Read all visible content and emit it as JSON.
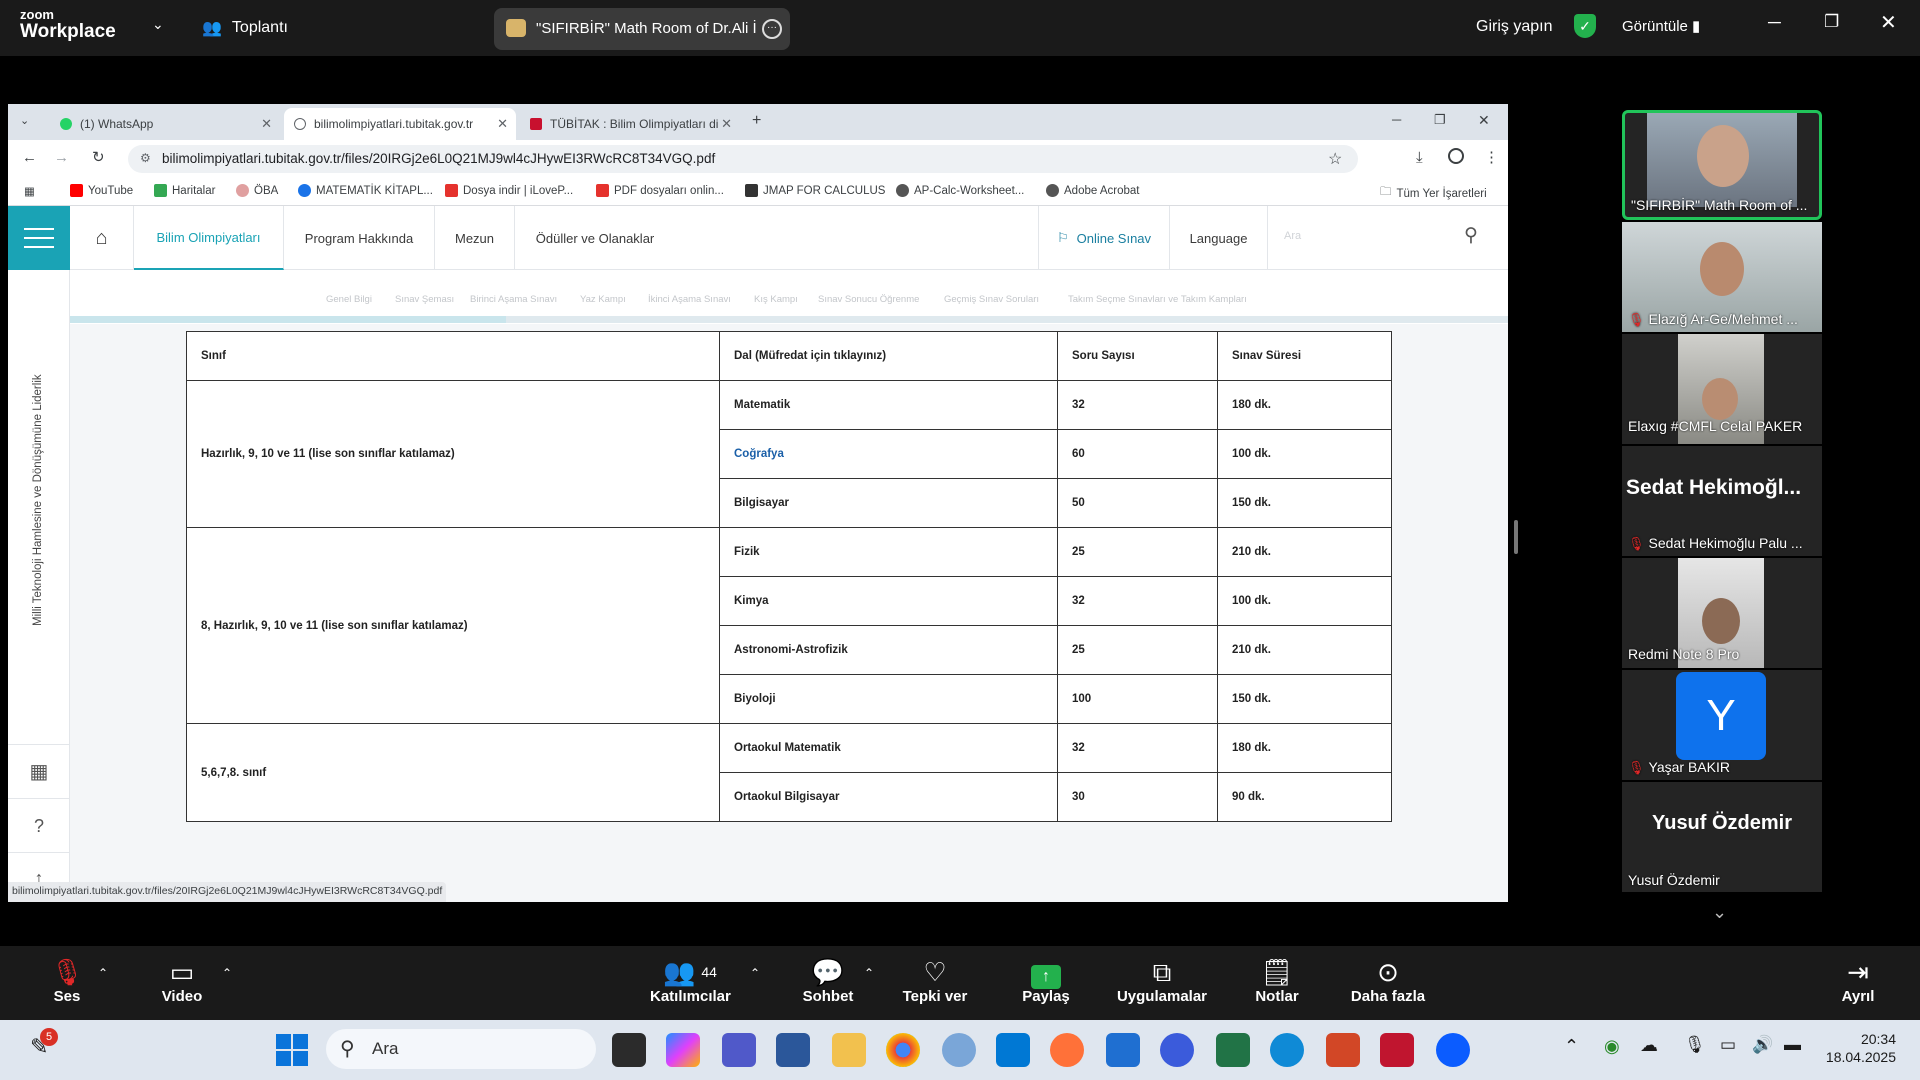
{
  "zoom": {
    "brand_top": "zoom",
    "brand_bottom": "Workplace",
    "meeting_menu": "Toplantı",
    "room_title": "\"SIFIRBİR\" Math Room of Dr.Ali İ",
    "signin": "Giriş yapın",
    "view": "Görüntüle"
  },
  "browser": {
    "tabs": [
      {
        "label": "(1) WhatsApp",
        "active": false
      },
      {
        "label": "bilimolimpiyatlari.tubitak.gov.tr",
        "active": true
      },
      {
        "label": "TÜBİTAK : Bilim Olimpiyatları di",
        "active": false
      }
    ],
    "url": "bilimolimpiyatlari.tubitak.gov.tr/files/20IRGj2e6L0Q21MJ9wl4cJHywEI3RWcRC8T34VGQ.pdf",
    "bookmarks": [
      "YouTube",
      "Haritalar",
      "ÖBA",
      "MATEMATİK KİTAPL...",
      "Dosya indir | iLoveP...",
      "PDF dosyaları onlin...",
      "JMAP FOR CALCULUS",
      "AP-Calc-Worksheet...",
      "Adobe Acrobat"
    ],
    "all_bookmarks": "Tüm Yer İşaretleri",
    "status_url": "bilimolimpiyatlari.tubitak.gov.tr/files/20IRGj2e6L0Q21MJ9wl4cJHywEI3RWcRC8T34VGQ.pdf"
  },
  "site": {
    "nav": [
      "Bilim Olimpiyatları",
      "Program Hakkında",
      "Mezun",
      "Ödüller ve Olanaklar"
    ],
    "online": "Online Sınav",
    "language": "Language",
    "search_placeholder": "Ara",
    "subnav": [
      "Genel Bilgi",
      "Sınav Şeması",
      "Birinci Aşama Sınavı",
      "Yaz Kampı",
      "İkinci Aşama Sınavı",
      "Kış Kampı",
      "Sınav Sonucu Öğrenme",
      "Geçmiş Sınav Soruları",
      "Takım Seçme Sınavları ve Takım Kampları"
    ],
    "sidebar_text": "Milli Teknoloji Hamlesine ve Dönüşümüne Liderlik"
  },
  "table": {
    "headers": [
      "Sınıf",
      "Dal (Müfredat için tıklayınız)",
      "Soru Sayısı",
      "Sınav Süresi"
    ],
    "groups": [
      {
        "class": "Hazırlık, 9, 10 ve 11 (lise son sınıflar katılamaz)",
        "rows": [
          [
            "Matematik",
            "32",
            "180 dk."
          ],
          [
            "Coğrafya",
            "60",
            "100 dk."
          ],
          [
            "Bilgisayar",
            "50",
            "150 dk."
          ]
        ]
      },
      {
        "class": "8, Hazırlık, 9, 10 ve 11 (lise son sınıflar katılamaz)",
        "rows": [
          [
            "Fizik",
            "25",
            "210 dk."
          ],
          [
            "Kimya",
            "32",
            "100 dk."
          ],
          [
            "Astronomi-Astrofizik",
            "25",
            "210 dk."
          ],
          [
            "Biyoloji",
            "100",
            "150 dk."
          ]
        ]
      },
      {
        "class": "5,6,7,8. sınıf",
        "rows": [
          [
            "Ortaokul Matematik",
            "32",
            "180 dk."
          ],
          [
            "Ortaokul Bilgisayar",
            "30",
            "90 dk."
          ]
        ]
      }
    ]
  },
  "participants": [
    {
      "name": "\"SIFIRBİR\" Math Room of ...",
      "muted": false
    },
    {
      "name": "Elazığ Ar-Ge/Mehmet ...",
      "muted": true
    },
    {
      "name": "Elaxıg #CMFL Celal PAKER",
      "muted": false
    },
    {
      "big": "Sedat Hekimoğl...",
      "name": "Sedat Hekimoğlu Palu ...",
      "muted": true
    },
    {
      "name": "Redmi Note 8 Pro",
      "muted": false
    },
    {
      "initial": "Y",
      "name": "Yaşar BAKIR",
      "muted": true
    },
    {
      "big": "Yusuf Özdemir",
      "name": "Yusuf Özdemir",
      "muted": false
    }
  ],
  "toolbar": {
    "audio": "Ses",
    "video": "Video",
    "participants": "Katılımcılar",
    "participants_count": "44",
    "chat": "Sohbet",
    "react": "Tepki ver",
    "share": "Paylaş",
    "apps": "Uygulamalar",
    "notes": "Notlar",
    "more": "Daha fazla",
    "leave": "Ayrıl"
  },
  "taskbar": {
    "search": "Ara",
    "time": "20:34",
    "date": "18.04.2025",
    "badge": "5"
  }
}
